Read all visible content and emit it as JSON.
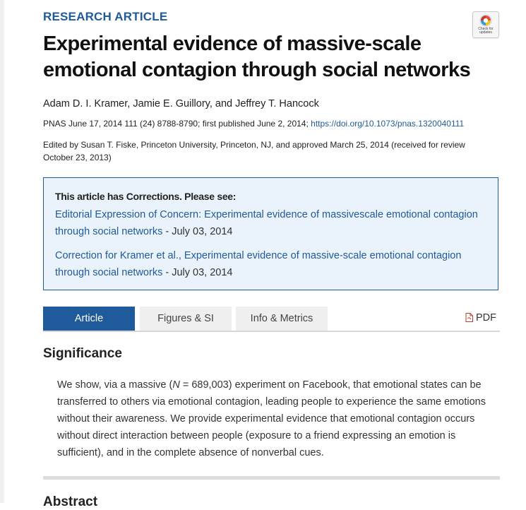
{
  "article": {
    "kicker": "RESEARCH ARTICLE",
    "check_badge_text": "Check for updates",
    "title": "Experimental evidence of massive-scale emotional contagion through social networks",
    "authors": "Adam D. I. Kramer, Jamie E. Guillory, and Jeffrey T. Hancock",
    "citation_text": "PNAS June 17, 2014 111 (24) 8788-8790; first published June 2, 2014; ",
    "doi_link": "https://doi.org/10.1073/pnas.1320040111",
    "edited": "Edited by Susan T. Fiske, Princeton University, Princeton, NJ, and approved March 25, 2014 (received for review October 23, 2013)"
  },
  "corrections": {
    "heading": "This article has Corrections. Please see:",
    "items": [
      {
        "link": "Editorial Expression of Concern: Experimental evidence of massivescale emotional contagion through social networks",
        "date": " - July 03, 2014"
      },
      {
        "link": "Correction for Kramer et al., Experimental evidence of massive-scale emotional contagion through social networks",
        "date": " - July 03, 2014"
      }
    ]
  },
  "tabs": [
    {
      "label": "Article",
      "active": true
    },
    {
      "label": "Figures & SI",
      "active": false
    },
    {
      "label": "Info & Metrics",
      "active": false
    }
  ],
  "pdf_label": "PDF",
  "significance": {
    "heading": "Significance",
    "body_prefix": "We show, via a massive (",
    "body_n": "N",
    "body_rest": " = 689,003) experiment on Facebook, that emotional states can be transferred to others via emotional contagion, leading people to experience the same emotions without their awareness. We provide experimental evidence that emotional contagion occurs without direct interaction between people (exposure to a friend expressing an emotion is sufficient), and in the complete absence of nonverbal cues."
  },
  "abstract_heading": "Abstract",
  "colors": {
    "accent": "#1f5a9a",
    "box_bg": "#eaf2fb",
    "tab_inactive": "#efefef",
    "pdf_icon": "#c0392b"
  }
}
